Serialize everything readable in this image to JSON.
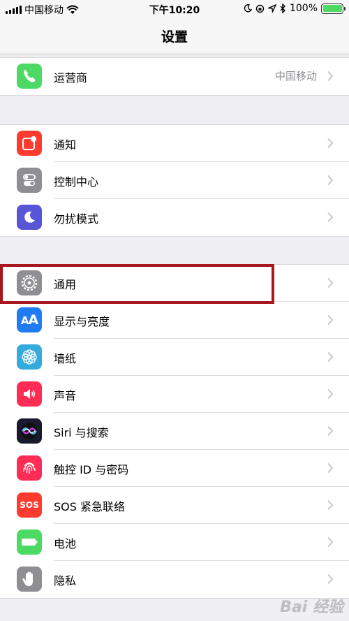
{
  "status_bar": {
    "carrier": "中国移动",
    "time": "下午10:20",
    "battery_percent": "100%",
    "battery_level": 1.0,
    "icons": [
      "signal-icon",
      "wifi-icon",
      "moon-icon",
      "rotation-lock-icon",
      "location-icon",
      "bluetooth-icon",
      "battery-icon"
    ]
  },
  "nav": {
    "title": "设置"
  },
  "groups": [
    {
      "rows": [
        {
          "label": "运营商",
          "value": "中国移动",
          "icon": "phone-icon",
          "color": "#4cd964"
        }
      ]
    },
    {
      "rows": [
        {
          "label": "通知",
          "icon": "notification-icon",
          "color": "#ff3b30"
        },
        {
          "label": "控制中心",
          "icon": "control-center-icon",
          "color": "#8e8e93"
        },
        {
          "label": "勿扰模式",
          "icon": "moon-icon",
          "color": "#5856d6"
        }
      ]
    },
    {
      "rows": [
        {
          "label": "通用",
          "icon": "gear-icon",
          "color": "#8e8e93"
        },
        {
          "label": "显示与亮度",
          "icon": "display-aa-icon",
          "color": "#1f7cf5",
          "icon_text": "AA"
        },
        {
          "label": "墙纸",
          "icon": "wallpaper-flower-icon",
          "color": "#35aadc"
        },
        {
          "label": "声音",
          "icon": "speaker-icon",
          "color": "#ff2d55"
        },
        {
          "label": "Siri 与搜索",
          "icon": "siri-icon",
          "color": "#1a1a2e"
        },
        {
          "label": "触控 ID 与密码",
          "icon": "fingerprint-icon",
          "color": "#ff2d55"
        },
        {
          "label": "SOS 紧急联络",
          "icon": "sos-icon",
          "color": "#ff3b30",
          "icon_text": "SOS"
        },
        {
          "label": "电池",
          "icon": "battery-icon",
          "color": "#4cd964"
        },
        {
          "label": "隐私",
          "icon": "hand-icon",
          "color": "#8e8e93"
        }
      ]
    }
  ],
  "watermark": "Bai 经验"
}
